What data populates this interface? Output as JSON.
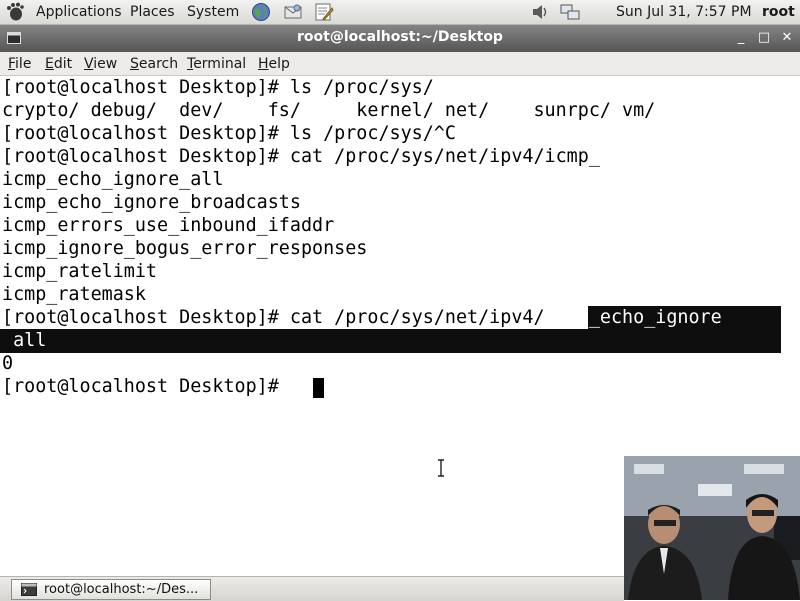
{
  "top_panel": {
    "menus": [
      "Applications",
      "Places",
      "System"
    ],
    "datetime": "Sun Jul 31,  7:57 PM",
    "user": "root",
    "icons": [
      "gnome-foot-icon",
      "globe-icon",
      "mail-icon",
      "edit-icon",
      "volume-icon",
      "network-icon"
    ]
  },
  "window": {
    "title": "root@localhost:~/Desktop",
    "menu": [
      {
        "mnemonic": "F",
        "rest": "ile"
      },
      {
        "mnemonic": "E",
        "rest": "dit"
      },
      {
        "mnemonic": "V",
        "rest": "iew"
      },
      {
        "mnemonic": "S",
        "rest": "earch"
      },
      {
        "mnemonic": "T",
        "rest": "erminal"
      },
      {
        "mnemonic": "H",
        "rest": "elp"
      }
    ]
  },
  "terminal": {
    "lines": [
      "[root@localhost Desktop]# ls /proc/sys/",
      "crypto/ debug/  dev/    fs/     kernel/ net/    sunrpc/ vm/",
      "[root@localhost Desktop]# ls /proc/sys/^C",
      "[root@localhost Desktop]# cat /proc/sys/net/ipv4/icmp_",
      "icmp_echo_ignore_all",
      "icmp_echo_ignore_broadcasts",
      "icmp_errors_use_inbound_ifaddr",
      "icmp_ignore_bogus_error_responses",
      "icmp_ratelimit",
      "icmp_ratemask"
    ],
    "selected_command_prefix": "[root@localhost Desktop]# cat /proc/sys/net/ipv4/",
    "selected_command_highlight": "icmp_echo_ignore",
    "selected_wrap": " all",
    "output": "0",
    "prompt": "[root@localhost Desktop]# "
  },
  "taskbar": {
    "item": "root@localhost:~/Des..."
  }
}
